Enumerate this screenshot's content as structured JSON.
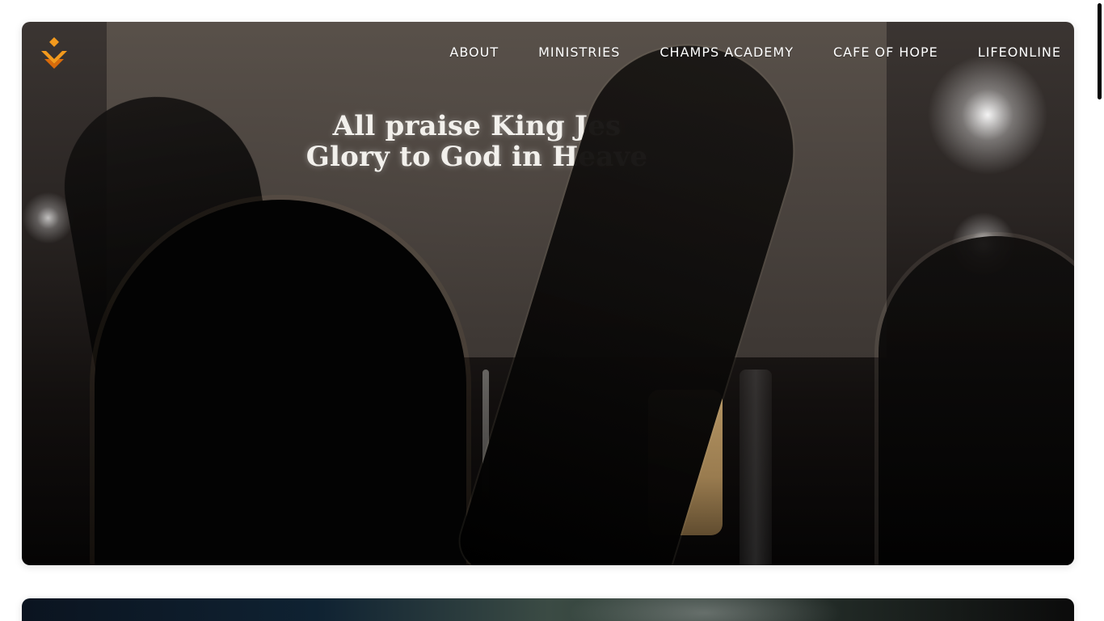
{
  "brand": {
    "accent_colors": [
      "#F39A1D",
      "#D86A0A"
    ]
  },
  "nav": {
    "items": [
      {
        "label": "ABOUT"
      },
      {
        "label": "MINISTRIES"
      },
      {
        "label": "CHAMPS ACADEMY"
      },
      {
        "label": "CAFE OF HOPE"
      },
      {
        "label": "LIFEONLINE"
      }
    ]
  },
  "hero": {
    "lyrics": {
      "line1": "All praise King Jes",
      "line2": "Glory to God in Heave"
    }
  },
  "icons": {
    "logo": "logo-icon"
  }
}
